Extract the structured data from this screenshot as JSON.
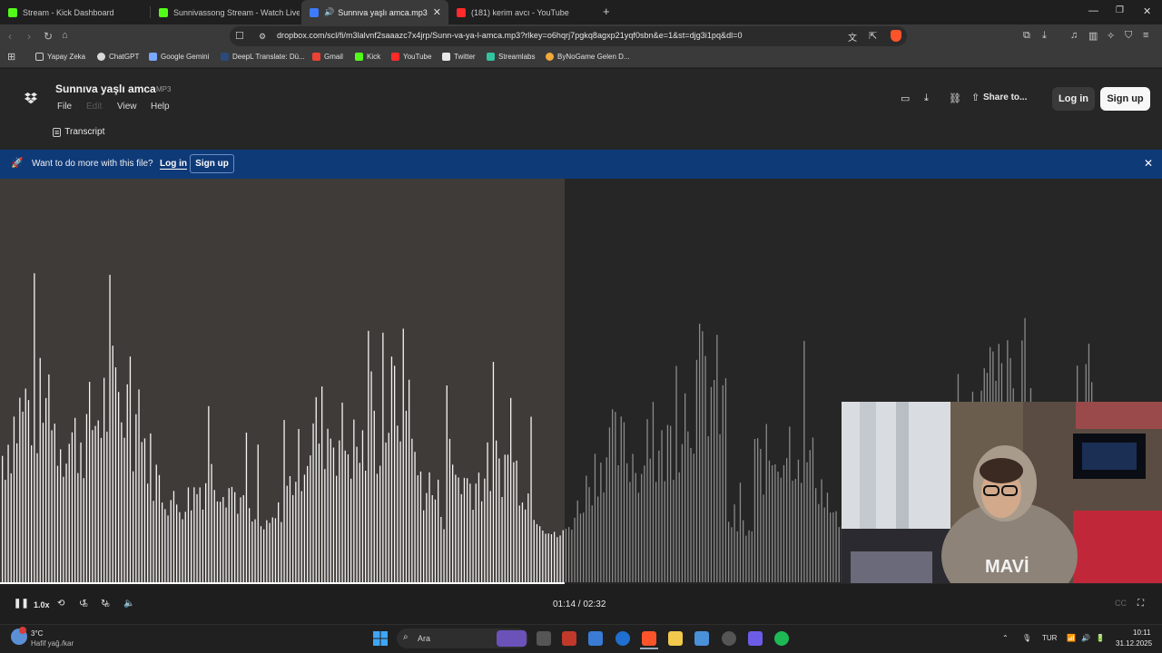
{
  "browser": {
    "tabs": [
      {
        "label": "Stream - Kick Dashboard",
        "favicon_color": "#53fc18"
      },
      {
        "label": "Sunnivassong Stream - Watch Live o",
        "favicon_color": "#53fc18"
      },
      {
        "label": "Sunnıva yaşlı amca.mp3",
        "favicon_color": "#3d7bfa"
      },
      {
        "label": "(181) kerim avcı - YouTube",
        "favicon_color": "#ff2a2a"
      }
    ],
    "url": "dropbox.com/scl/fi/m3lalvnf2saaazc7x4jrp/Sunn-va-ya-l-amca.mp3?rlkey=o6hqrj7pgkq8agxp21yqf0sbn&e=1&st=djg3i1pq&dl=0",
    "bookmarks": [
      {
        "label": "Yapay Zeka",
        "color": "#cfcfcf"
      },
      {
        "label": "ChatGPT",
        "color": "#d9d9d9"
      },
      {
        "label": "Google Gemini",
        "color": "#7aa7ff"
      },
      {
        "label": "DeepL Translate: Dü...",
        "color": "#2a4a7a"
      },
      {
        "label": "Gmail",
        "color": "#ea4335"
      },
      {
        "label": "Kick",
        "color": "#53fc18"
      },
      {
        "label": "YouTube",
        "color": "#ff2a2a"
      },
      {
        "label": "Twitter",
        "color": "#e8e8e8"
      },
      {
        "label": "Streamlabs",
        "color": "#31c3a2"
      },
      {
        "label": "ByNoGame Gelen D...",
        "color": "#f2a93b"
      }
    ]
  },
  "dropbox": {
    "file_name": "Sunnıva yaşlı amca",
    "file_type": "MP3",
    "menus": [
      "File",
      "Edit",
      "View",
      "Help"
    ],
    "transcript_label": "Transcript",
    "share_label": "Share to...",
    "login_label": "Log in",
    "signup_label": "Sign up",
    "banner": {
      "text": "Want to do more with this file?",
      "login": "Log in",
      "signup": "Sign up"
    },
    "player": {
      "speed": "1.0x",
      "skip_back": "10",
      "skip_forward": "10",
      "time": "01:14 / 02:32",
      "progress": 0.486
    }
  },
  "taskbar": {
    "weather_temp": "3°C",
    "weather_desc": "Hafif yağ./kar",
    "search_placeholder": "Ara",
    "language": "TUR",
    "time": "10:11",
    "date": "31.12.2025"
  }
}
